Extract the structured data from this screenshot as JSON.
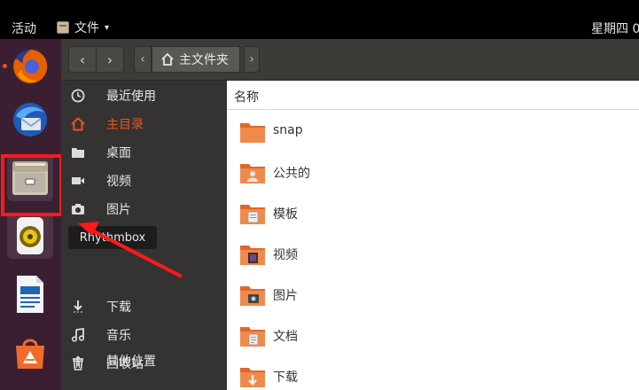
{
  "topbar": {
    "activities": "活动",
    "app_menu": "文件",
    "clock": "星期四 0"
  },
  "dock": {
    "items": [
      {
        "name": "firefox",
        "icon": "firefox-icon"
      },
      {
        "name": "thunderbird",
        "icon": "thunderbird-icon"
      },
      {
        "name": "files",
        "icon": "files-icon"
      },
      {
        "name": "rhythmbox",
        "icon": "rhythmbox-icon"
      },
      {
        "name": "writer",
        "icon": "libreoffice-writer-icon"
      },
      {
        "name": "software",
        "icon": "ubuntu-software-icon"
      }
    ],
    "tooltip": "Rhythmbox"
  },
  "header": {
    "back": "‹",
    "forward": "›",
    "path_left": "‹",
    "path_right": "›",
    "location": "主文件夹"
  },
  "sidebar": {
    "items": [
      {
        "label": "最近使用",
        "icon": "clock-icon"
      },
      {
        "label": "主目录",
        "icon": "home-icon",
        "active": true
      },
      {
        "label": "桌面",
        "icon": "folder-icon"
      },
      {
        "label": "视频",
        "icon": "video-icon"
      },
      {
        "label": "图片",
        "icon": "camera-icon"
      },
      {
        "label": "下载",
        "icon": "download-icon"
      },
      {
        "label": "音乐",
        "icon": "music-icon"
      },
      {
        "label": "回收站",
        "icon": "trash-icon"
      },
      {
        "label": "其他位置",
        "icon": "plus-icon"
      }
    ]
  },
  "content": {
    "column_name": "名称",
    "files": [
      {
        "label": "snap",
        "icon": "folder-icon"
      },
      {
        "label": "公共的",
        "icon": "folder-public-icon"
      },
      {
        "label": "模板",
        "icon": "folder-templates-icon"
      },
      {
        "label": "视频",
        "icon": "folder-videos-icon"
      },
      {
        "label": "图片",
        "icon": "folder-pictures-icon"
      },
      {
        "label": "文档",
        "icon": "folder-documents-icon"
      },
      {
        "label": "下载",
        "icon": "folder-download-icon"
      }
    ]
  },
  "colors": {
    "accent": "#e95420",
    "dock_bg": "#3a1f33",
    "sidebar_bg": "#343331",
    "annotation_red": "#ff1a1a"
  }
}
